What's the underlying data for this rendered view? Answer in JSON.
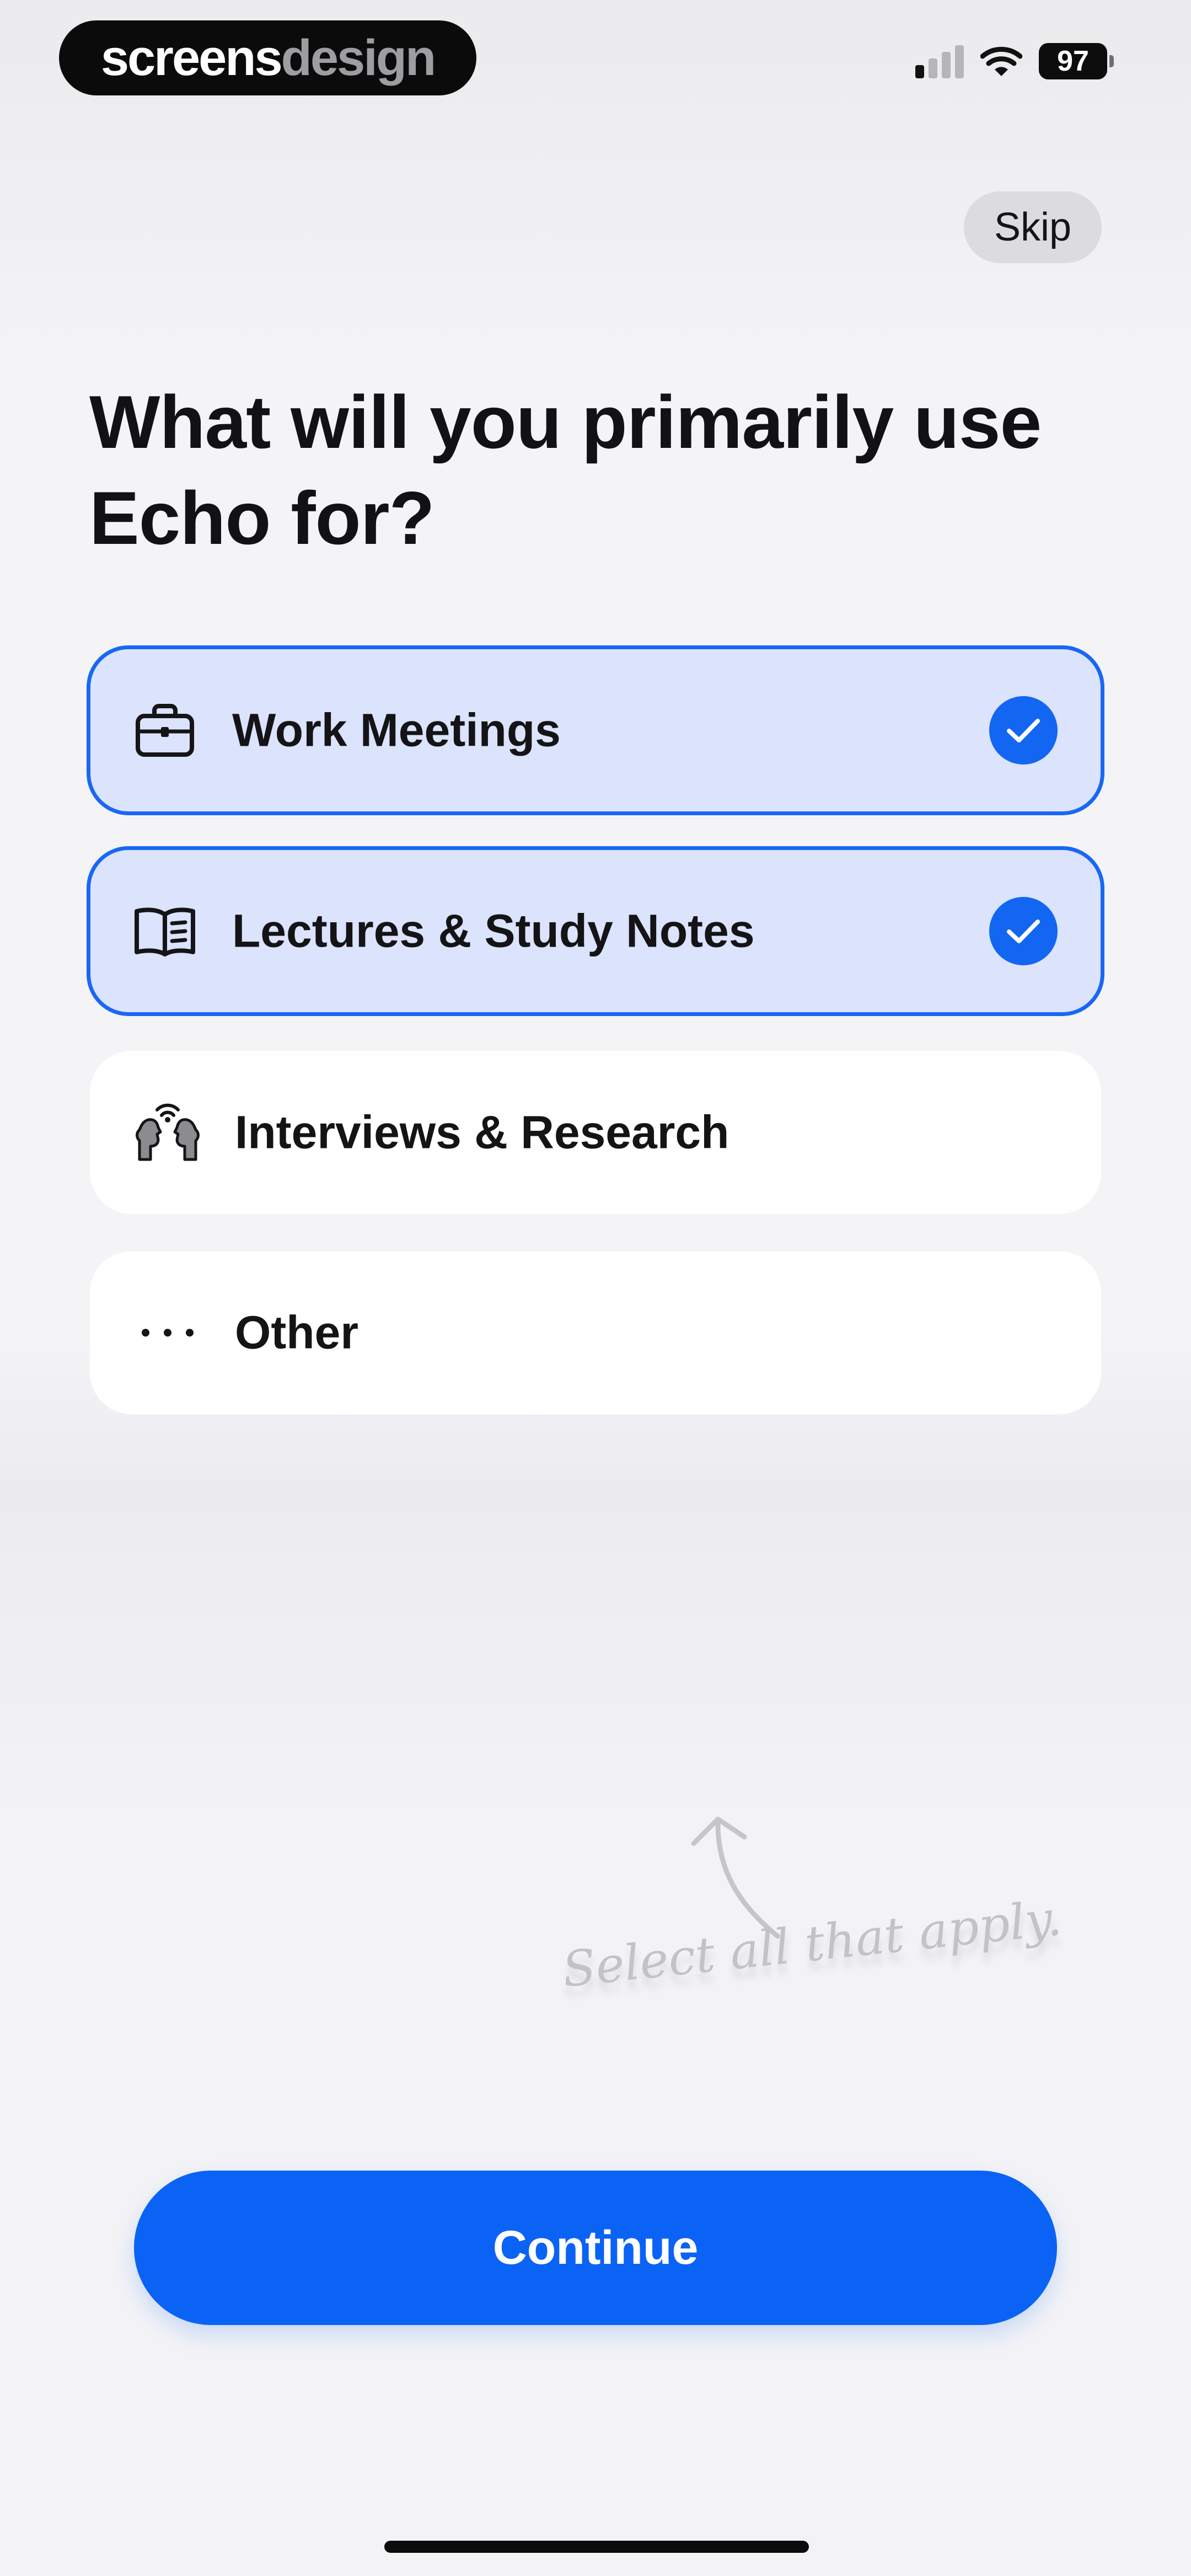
{
  "status_bar": {
    "brand_part1": "screens",
    "brand_part2": "design",
    "battery_level": "97",
    "signal_bars_active": 1,
    "signal_bars_total": 4,
    "wifi_icon": "wifi-icon",
    "battery_icon": "battery-icon"
  },
  "header": {
    "skip_label": "Skip"
  },
  "main": {
    "title": "What will you primarily use Echo for?",
    "options": [
      {
        "label": "Work Meetings",
        "icon": "briefcase-icon",
        "selected": true
      },
      {
        "label": "Lectures & Study Notes",
        "icon": "open-book-icon",
        "selected": true
      },
      {
        "label": "Interviews & Research",
        "icon": "two-faces-talking-icon",
        "selected": false
      },
      {
        "label": "Other",
        "icon": "ellipsis-icon",
        "selected": false
      }
    ],
    "hint": "Select all that apply.",
    "hint_icon": "curved-arrow-up-icon"
  },
  "footer": {
    "continue_label": "Continue"
  },
  "colors": {
    "accent": "#0a63f4",
    "selected_fill": "#dbe3fd",
    "selected_border": "#1967f4",
    "background": "#f3f3f6",
    "card": "#ffffff"
  }
}
